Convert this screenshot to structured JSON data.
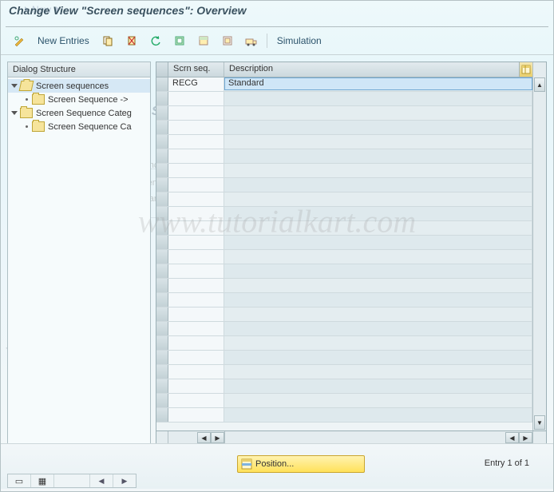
{
  "title": "Change View \"Screen sequences\": Overview",
  "toolbar": {
    "new_entries_label": "New Entries",
    "simulation_label": "Simulation"
  },
  "tree": {
    "header": "Dialog Structure",
    "nodes": {
      "screen_sequences": "Screen sequences",
      "screen_sequence_to": "Screen Sequence ->",
      "screen_sequence_categ": "Screen Sequence Categ",
      "screen_sequence_cat_child": "Screen Sequence Ca"
    }
  },
  "grid": {
    "columns": {
      "scrn_seq": "Scrn seq.",
      "description": "Description"
    },
    "rows": [
      {
        "scrn_seq": "RECG",
        "description": "Standard"
      }
    ]
  },
  "footer": {
    "position_label": "Position...",
    "entry_text": "Entry 1 of 1"
  },
  "ghost": {
    "new_label": "New",
    "title": "Screen Configuration",
    "section": "Screen Sequence Selection",
    "cats": "Screen Sequence Cats",
    "config": "Configuration",
    "standard": "Standard"
  },
  "watermark": "www.tutorialkart.com"
}
